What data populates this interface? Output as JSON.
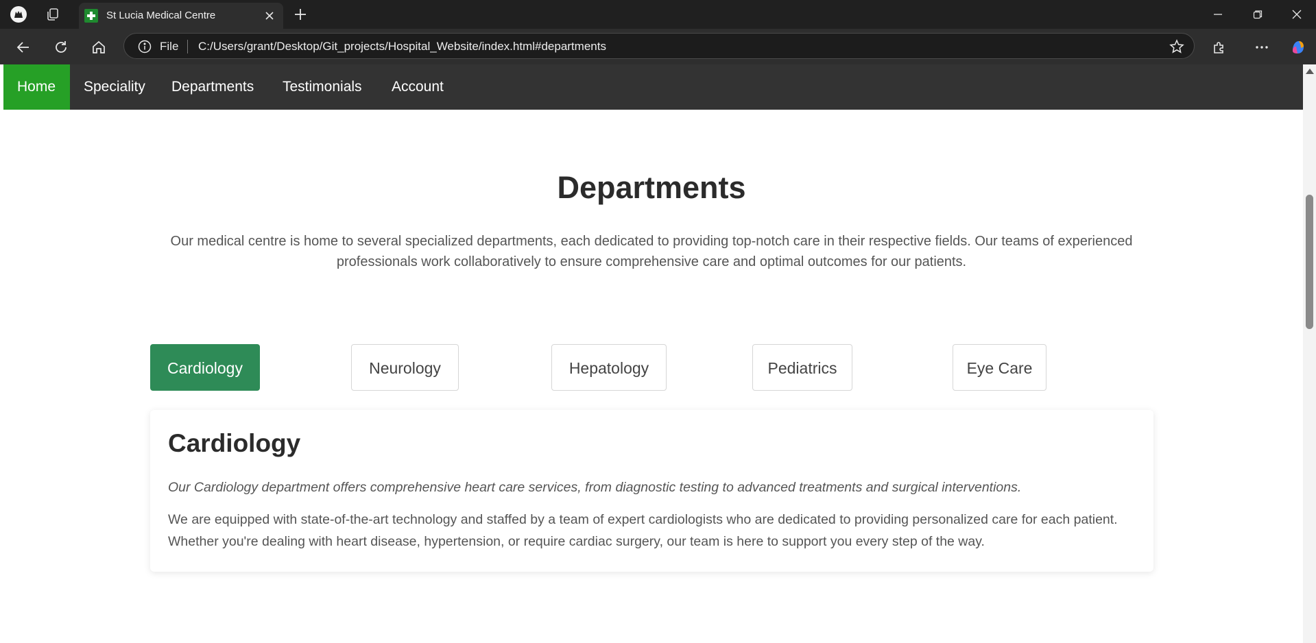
{
  "browser": {
    "tab_title": "St Lucia Medical Centre",
    "omnibox_scheme": "File",
    "url": "C:/Users/grant/Desktop/Git_projects/Hospital_Website/index.html#departments"
  },
  "site_nav": {
    "items": [
      "Home",
      "Speciality",
      "Departments",
      "Testimonials",
      "Account"
    ],
    "active": "Home"
  },
  "departments": {
    "title": "Departments",
    "intro": "Our medical centre is home to several specialized departments, each dedicated to providing top-notch care in their respective fields. Our teams of experienced professionals work collaboratively to ensure comprehensive care and optimal outcomes for our patients.",
    "tabs": [
      "Cardiology",
      "Neurology",
      "Hepatology",
      "Pediatrics",
      "Eye Care"
    ],
    "active_tab": "Cardiology",
    "panel": {
      "title": "Cardiology",
      "lead": "Our Cardiology department offers comprehensive heart care services, from diagnostic testing to advanced treatments and surgical interventions.",
      "body": "We are equipped with state-of-the-art technology and staffed by a team of expert cardiologists who are dedicated to providing personalized care for each patient. Whether you're dealing with heart disease, hypertension, or require cardiac surgery, our team is here to support you every step of the way."
    }
  },
  "colors": {
    "nav_bg": "#333333",
    "nav_active": "#26a026",
    "tab_active": "#2e8b57"
  }
}
